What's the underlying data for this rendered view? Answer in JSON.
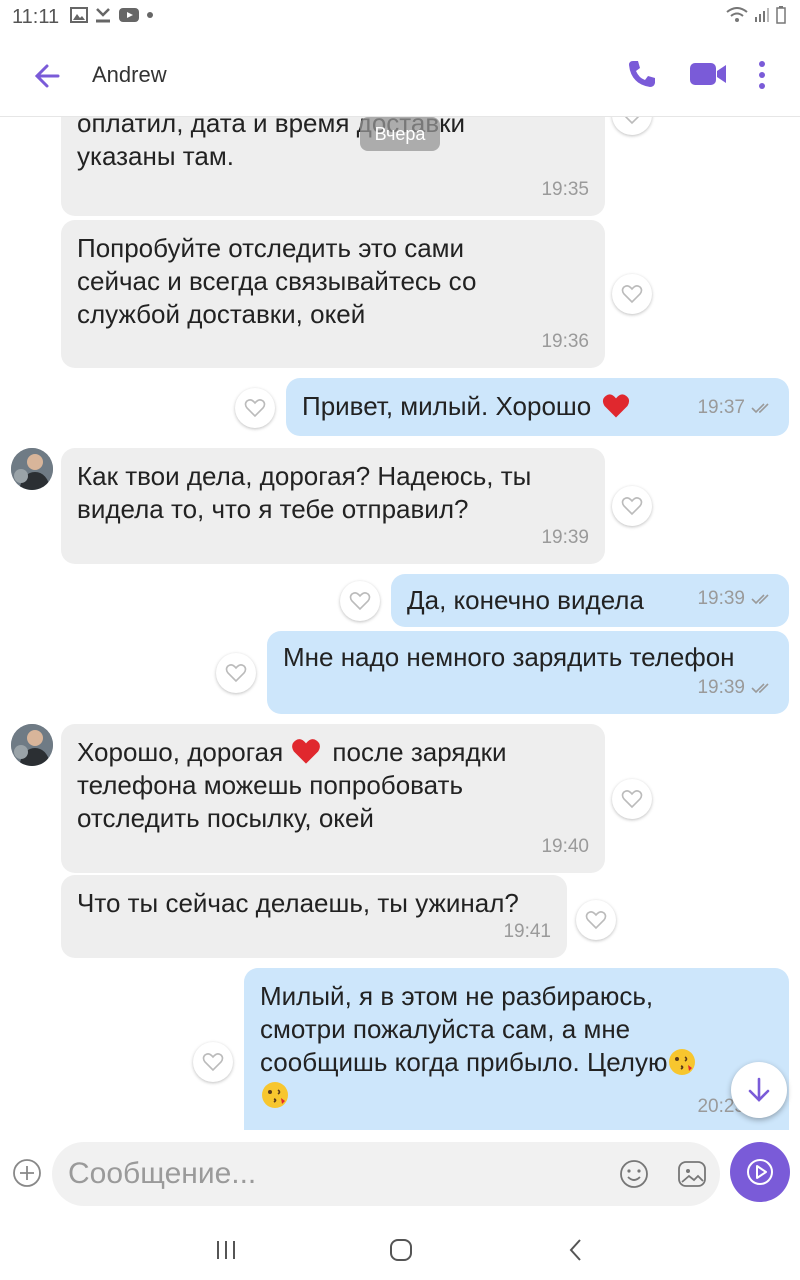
{
  "status_bar": {
    "time": "11:11"
  },
  "header": {
    "contact_name": "Andrew"
  },
  "chat": {
    "date_chip": "Вчера",
    "messages": [
      {
        "dir": "in",
        "text": "оплатил, дата и время доставки\nуказаны там.",
        "time": "19:35"
      },
      {
        "dir": "in",
        "text": "Попробуйте отследить это сами\nсейчас и всегда связывайтесь со\nслужбой доставки, окей",
        "time": "19:36"
      },
      {
        "dir": "out",
        "text": "Привет,  милый. Хорошо",
        "time": "19:37"
      },
      {
        "dir": "in",
        "text": "Как твои дела, дорогая? Надеюсь, ты\nвидела то, что я тебе отправил?",
        "time": "19:39"
      },
      {
        "dir": "out",
        "text": "Да, конечно видела",
        "time": "19:39"
      },
      {
        "dir": "out",
        "text": "Мне надо немного зарядить телефон",
        "time": "19:39"
      },
      {
        "dir": "in",
        "text_a": "Хорошо, дорогая",
        "text_b": " после зарядки\nтелефона можешь попробовать\nотследить посылку, окей",
        "time": "19:40"
      },
      {
        "dir": "in",
        "text": "Что ты сейчас делаешь, ты ужинал?",
        "time": "19:41"
      },
      {
        "dir": "out",
        "text": "Милый, я в этом не разбираюсь,\nсмотри пожалуйста сам, а мне\nсообщишь когда прибыло.  Целую",
        "time": "20:25"
      }
    ]
  },
  "composer": {
    "placeholder": "Сообщение..."
  },
  "colors": {
    "accent": "#7a5bd8",
    "incoming_bubble": "#eeeeee",
    "outgoing_bubble": "#cde6fb",
    "heart": "#e0282e"
  }
}
